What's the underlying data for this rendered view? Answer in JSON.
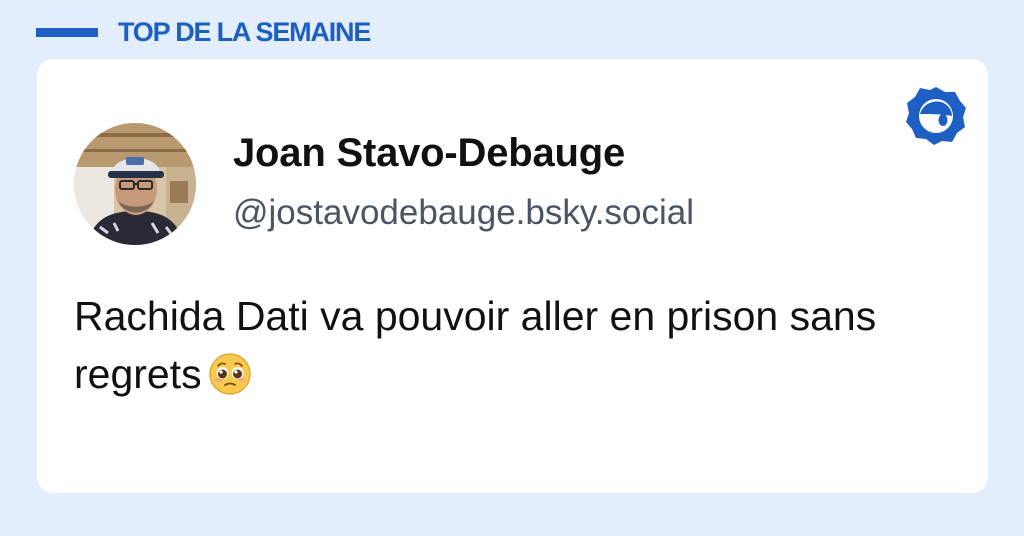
{
  "section": {
    "title": "TOP DE LA SEMAINE"
  },
  "post": {
    "author_name": "Joan Stavo-Debauge",
    "author_handle": "@jostavodebauge.bsky.social",
    "text": "Rachida Dati va pouvoir aller en prison sans regrets",
    "emoji": "pleading-face-icon"
  },
  "icons": {
    "brand": "bluesky-badge-icon",
    "avatar": "avatar"
  },
  "colors": {
    "background": "#e3eefc",
    "accent": "#1e5fc4",
    "card": "#ffffff",
    "handle": "#4a5563",
    "text": "#111111"
  }
}
